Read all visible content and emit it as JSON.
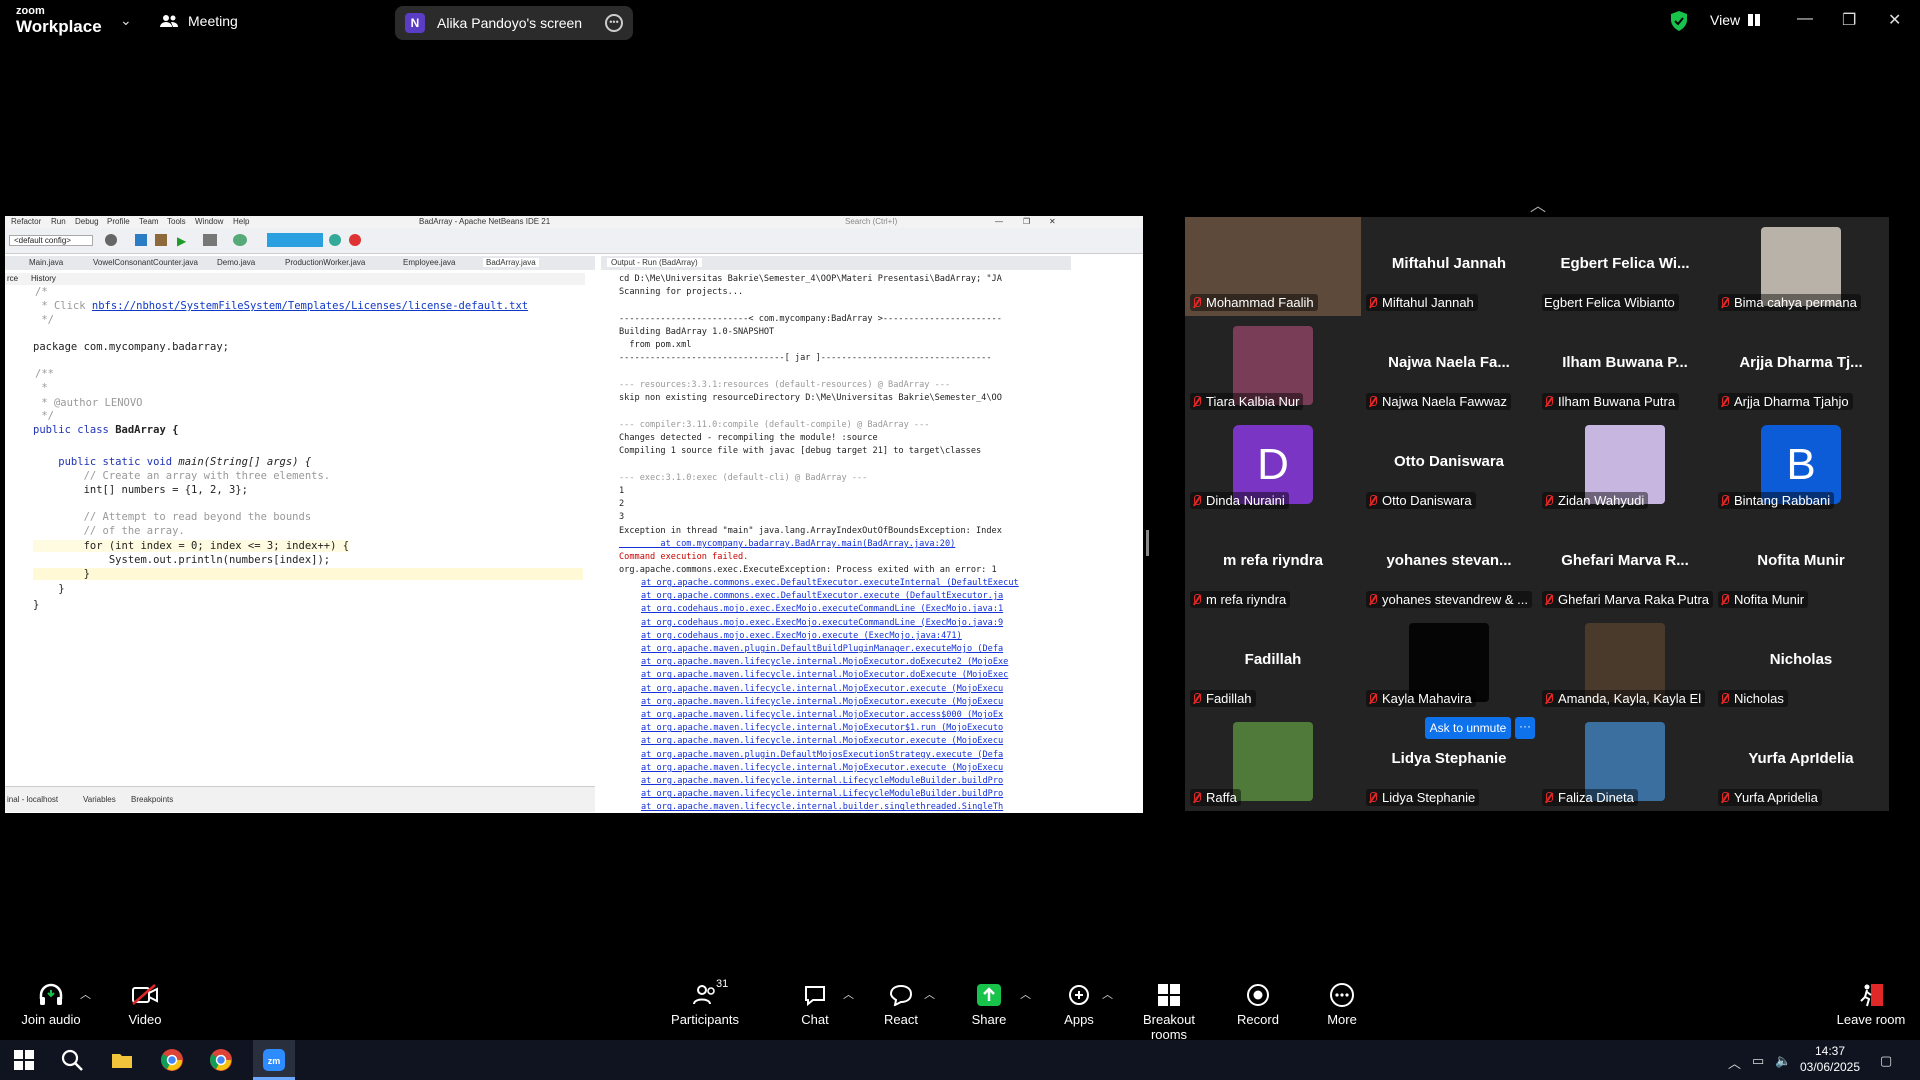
{
  "app": {
    "brand_line1": "zoom",
    "brand_line2": "Workplace",
    "meeting_label": "Meeting",
    "share_initial": "N",
    "share_label": "Alika Pandoyo's screen",
    "view_label": "View",
    "accent": "#0e72ed",
    "shield_color": "#17c34a",
    "muted_color": "#e02828"
  },
  "ide": {
    "title": "BadArray - Apache NetBeans IDE 21",
    "menus": [
      "Refactor",
      "Run",
      "Debug",
      "Profile",
      "Team",
      "Tools",
      "Window",
      "Help"
    ],
    "config": "<default config>",
    "search": "Search (Ctrl+I)",
    "tabs": [
      "Main.java",
      "VowelConsonantCounter.java",
      "Demo.java",
      "ProductionWorker.java",
      "Employee.java",
      "BadArray.java"
    ],
    "source_tab": "rce",
    "history_tab": "History",
    "output_tab": "Output - Run (BadArray)",
    "bottom_tabs": [
      "inal - localhost",
      "Variables",
      "Breakpoints"
    ],
    "code": {
      "l1": "/*",
      "l2a": " * Click ",
      "l2b": "nbfs://nbhost/SystemFileSystem/Templates/Licenses/license-default.txt",
      "l3": " */",
      "l4": "package com.mycompany.badarray;",
      "l5": "/**",
      "l6": " *",
      "l7a": " * @author ",
      "l7b": "LENOVO",
      "l8": " */",
      "l9a": "public class ",
      "l9b": "BadArray {",
      "l10a": "    public static void ",
      "l10b": "main(String[] args) {",
      "l11": "        // Create an array with three elements.",
      "l12": "        int[] numbers = {1, 2, 3};",
      "l13": "        // Attempt to read beyond the bounds",
      "l14": "        // of the array.",
      "l15": "        for (int index = 0; index <= 3; index++) {",
      "l16": "            System.out.println(numbers[index]);",
      "l17": "        }",
      "l18": "    }",
      "l19": "}"
    },
    "output": {
      "o1": "cd D:\\Me\\Universitas Bakrie\\Semester_4\\OOP\\Materi Presentasi\\BadArray; \"JA",
      "o2": "Scanning for projects...",
      "o3": "-------------------------< com.mycompany:BadArray >-----------------------",
      "o4": "Building BadArray 1.0-SNAPSHOT",
      "o5": "  from pom.xml",
      "o6": "--------------------------------[ jar ]---------------------------------",
      "o7": "--- resources:3.3.1:resources (default-resources) @ BadArray ---",
      "o8": "skip non existing resourceDirectory D:\\Me\\Universitas Bakrie\\Semester_4\\OO",
      "o9": "--- compiler:3.11.0:compile (default-compile) @ BadArray ---",
      "o10": "Changes detected - recompiling the module! :source",
      "o11": "Compiling 1 source file with javac [debug target 21] to target\\classes",
      "o12": "--- exec:3.1.0:exec (default-cli) @ BadArray ---",
      "o13": "1",
      "o14": "2",
      "o15": "3",
      "o16": "Exception in thread \"main\" java.lang.ArrayIndexOutOfBoundsException: Index",
      "o17": "        at com.mycompany.badarray.BadArray.main(BadArray.java:20)",
      "o18": "Command execution failed.",
      "o19": "org.apache.commons.exec.ExecuteException: Process exited with an error: 1",
      "stack": [
        "at org.apache.commons.exec.DefaultExecutor.executeInternal (DefaultExecut",
        "at org.apache.commons.exec.DefaultExecutor.execute (DefaultExecutor.ja",
        "at org.codehaus.mojo.exec.ExecMojo.executeCommandLine (ExecMojo.java:1",
        "at org.codehaus.mojo.exec.ExecMojo.executeCommandLine (ExecMojo.java:9",
        "at org.codehaus.mojo.exec.ExecMojo.execute (ExecMojo.java:471)",
        "at org.apache.maven.plugin.DefaultBuildPluginManager.executeMojo (Defa",
        "at org.apache.maven.lifecycle.internal.MojoExecutor.doExecute2 (MojoExe",
        "at org.apache.maven.lifecycle.internal.MojoExecutor.doExecute (MojoExec",
        "at org.apache.maven.lifecycle.internal.MojoExecutor.execute (MojoExecu",
        "at org.apache.maven.lifecycle.internal.MojoExecutor.execute (MojoExecu",
        "at org.apache.maven.lifecycle.internal.MojoExecutor.access$000 (MojoEx",
        "at org.apache.maven.lifecycle.internal.MojoExecutor$1.run (MojoExecuto",
        "at org.apache.maven.lifecycle.internal.MojoExecutor.execute (MojoExecu",
        "at org.apache.maven.plugin.DefaultMojosExecutionStrategy.execute (Defa",
        "at org.apache.maven.lifecycle.internal.MojoExecutor.execute (MojoExecu",
        "at org.apache.maven.lifecycle.internal.LifecycleModuleBuilder.buildPro",
        "at org.apache.maven.lifecycle.internal.LifecycleModuleBuilder.buildPro",
        "at org.apache.maven.lifecycle.internal.builder.singlethreaded.SingleTh"
      ]
    }
  },
  "participants": [
    {
      "big": "",
      "label": "Mohammad Faalih",
      "photo": "#5d4a3a"
    },
    {
      "big": "Miftahul Jannah",
      "label": "Miftahul Jannah"
    },
    {
      "big": "Egbert Felica Wi...",
      "label": "Egbert Felica Wibianto"
    },
    {
      "big": "",
      "label": "Bima cahya permana",
      "photo": "#b9b2a8"
    },
    {
      "big": "",
      "label": "Tiara Kalbia Nur",
      "photo": "#7a3d57"
    },
    {
      "big": "Najwa Naela Fa...",
      "label": "Najwa Naela Fawwaz"
    },
    {
      "big": "Ilham Buwana P...",
      "label": "Ilham Buwana Putra"
    },
    {
      "big": "Arjja Dharma Tj...",
      "label": "Arjja Dharma Tjahjo"
    },
    {
      "big": "",
      "label": "Dinda Nuraini",
      "letter": "D",
      "color": "#7b35c5"
    },
    {
      "big": "Otto Daniswara",
      "label": "Otto Daniswara"
    },
    {
      "big": "",
      "label": "Zidan Wahyudi",
      "photo": "#c7b7e0"
    },
    {
      "big": "",
      "label": "Bintang Rabbani",
      "letter": "B",
      "color": "#0b5cd6"
    },
    {
      "big": "m refa riyndra",
      "label": "m refa riyndra"
    },
    {
      "big": "yohanes stevan...",
      "label": "yohanes stevandrew & ..."
    },
    {
      "big": "Ghefari Marva R...",
      "label": "Ghefari Marva Raka Putra"
    },
    {
      "big": "Nofita Munir",
      "label": "Nofita Munir"
    },
    {
      "big": "Fadillah",
      "label": "Fadillah"
    },
    {
      "big": "",
      "label": "Kayla Mahavira",
      "photo": "#050505"
    },
    {
      "big": "",
      "label": "Amanda, Kayla, Kayla El",
      "photo": "#4a3a2c"
    },
    {
      "big": "Nicholas",
      "label": "Nicholas"
    },
    {
      "big": "",
      "label": "Raffa",
      "photo": "#4f7a3a"
    },
    {
      "big": "Lidya Stephanie",
      "label": "Lidya Stephanie"
    },
    {
      "big": "",
      "label": "Faliza Dineta",
      "photo": "#3a6fa0"
    },
    {
      "big": "Yurfa AprIdelia",
      "label": "Yurfa Apridelia"
    }
  ],
  "ask_unmute": "Ask to unmute",
  "ask_more": "···",
  "controls": {
    "join_audio": "Join audio",
    "video": "Video",
    "participants": "Participants",
    "participants_count": "31",
    "chat": "Chat",
    "react": "React",
    "share": "Share",
    "apps": "Apps",
    "breakout": "Breakout rooms",
    "record": "Record",
    "more": "More",
    "leave": "Leave room"
  },
  "taskbar": {
    "time": "14:37",
    "date": "03/06/2025"
  }
}
